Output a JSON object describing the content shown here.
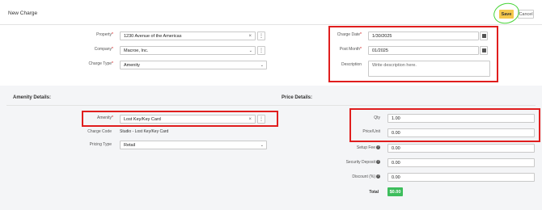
{
  "header": {
    "title": "New Charge",
    "save_label": "Save",
    "cancel_label": "Cancel"
  },
  "form": {
    "property_label": "Property",
    "property_value": "1230 Avenue of the Americas",
    "company_label": "Company",
    "company_value": "Macroe, Inc.",
    "charge_type_label": "Charge Type",
    "charge_type_value": "Amenity",
    "charge_date_label": "Charge Date",
    "charge_date_value": "1/30/2025",
    "post_month_label": "Post Month",
    "post_month_value": "01/2025",
    "description_label": "Description",
    "description_placeholder": "Write description here.",
    "required_mark": "*"
  },
  "amenity": {
    "section_title": "Amenity Details:",
    "amenity_label": "Amenity",
    "amenity_value": "Lost Key/Key Card",
    "charge_code_label": "Charge Code",
    "charge_code_value": "Studio - Lost Key/Key Card",
    "pricing_type_label": "Pricing Type",
    "pricing_type_value": "Retail"
  },
  "price": {
    "section_title": "Price Details:",
    "qty_label": "Qty",
    "qty_value": "1.00",
    "price_unit_label": "Price/Unit",
    "price_unit_value": "0.00",
    "setup_fee_label": "Setup Fee",
    "setup_fee_value": "0.00",
    "security_deposit_label": "Security Deposit",
    "security_deposit_value": "0.00",
    "discount_label": "Discount (%)",
    "discount_value": "0.00",
    "total_label": "Total",
    "total_value": "$0.00"
  },
  "icons": {
    "clear": "×",
    "more": "⋮",
    "caret": "⌄",
    "help": "?"
  },
  "colors": {
    "save_button": "#f5c84c",
    "annotation_red": "#e01e1e",
    "annotation_green": "#46d436",
    "total_badge": "#3dbd5c"
  }
}
